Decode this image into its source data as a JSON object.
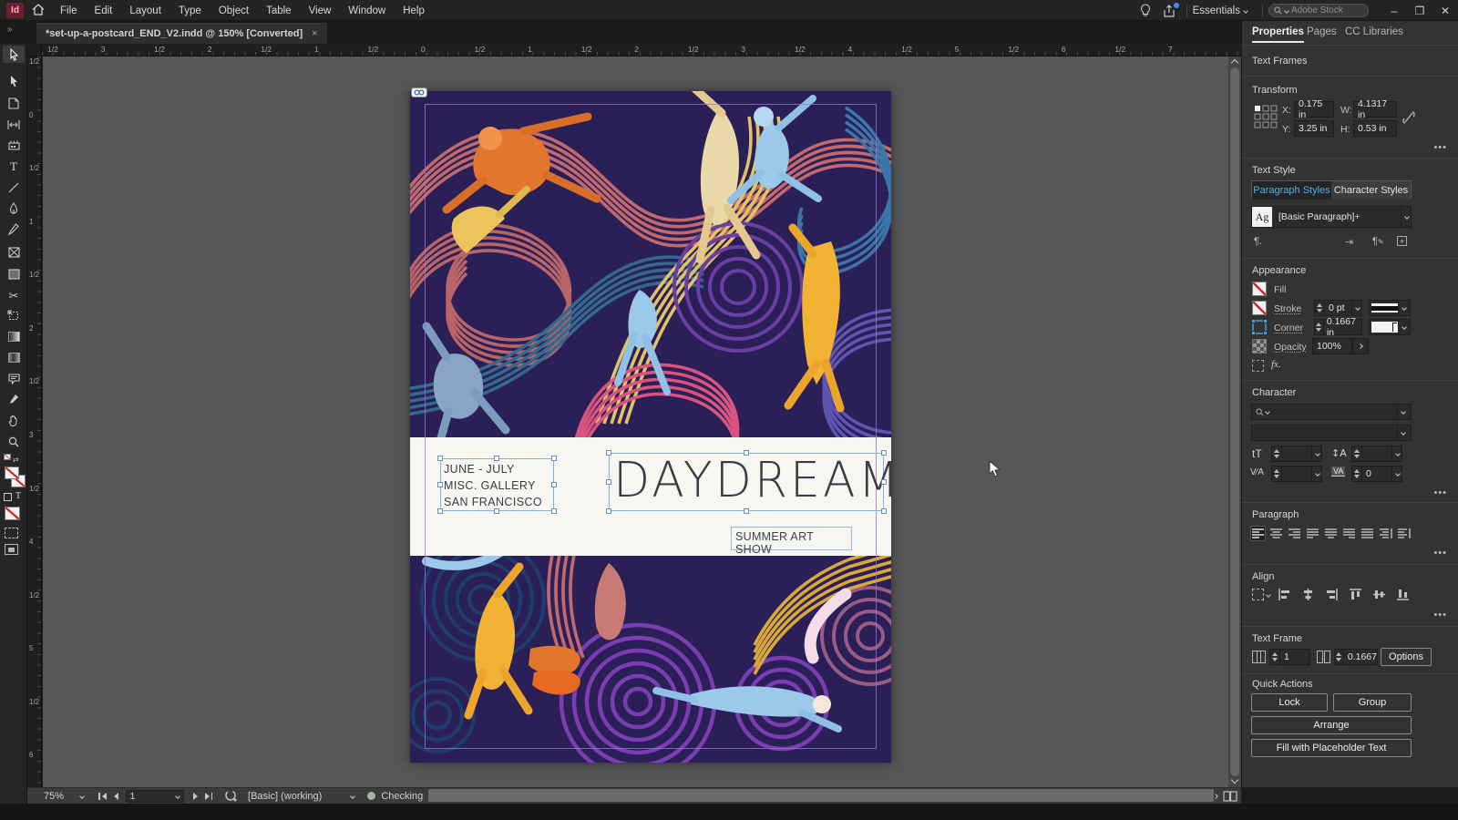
{
  "window": {
    "app_badge": "Id",
    "menu": [
      "File",
      "Edit",
      "Layout",
      "Type",
      "Object",
      "Table",
      "View",
      "Window",
      "Help"
    ],
    "workspace": "Essentials",
    "search_placeholder": "Adobe Stock",
    "min_label": "–",
    "restore_label": "❐",
    "close_label": "✕"
  },
  "icons": {
    "more": "•••",
    "expand": "»",
    "fx": "fx.",
    "pilcrow": "¶.",
    "pilcrow_edit": "¶",
    "plus_box": "+",
    "ag": "Ag",
    "size": "tT",
    "leading": "↕A",
    "kerning": "V⁄A",
    "tracking": "VA"
  },
  "tab": {
    "title": "*set-up-a-postcard_END_V2.indd @ 150% [Converted]",
    "close": "×"
  },
  "rulers": {
    "h": [
      "1/2",
      "3",
      "1/2",
      "2",
      "1/2",
      "1",
      "1/2",
      "0",
      "1/2",
      "1",
      "1/2",
      "2",
      "1/2",
      "3",
      "1/2",
      "4",
      "1/2",
      "5",
      "1/2",
      "6",
      "1/2",
      "7"
    ],
    "v": [
      "1/2",
      "0",
      "1/2",
      "1",
      "1/2",
      "2",
      "1/2",
      "3",
      "1/2",
      "4",
      "1/2",
      "5",
      "1/2",
      "6"
    ]
  },
  "postcard": {
    "dates": "JUNE - JULY\nMISC. GALLERY\nSAN FRANCISCO",
    "title": "DAYDREAM",
    "subtitle": "SUMMER ART SHOW",
    "palette": {
      "background": "#2a2057",
      "salmon": "#c2696e",
      "blue": "#33688f",
      "purple": "#7a3db2",
      "magenta": "#d8547e",
      "yellow": "#ecc45c",
      "orange": "#e2762d",
      "cream": "#ead9a8",
      "light_blue": "#9cc8ea",
      "steel": "#88a6c4",
      "navy_swirl": "#1e3c6e",
      "mauve": "#9a5a86",
      "band": "#f8f6f1"
    },
    "guide_color": "#9276cd",
    "selection_color": "#7db3de"
  },
  "panel": {
    "tabs": [
      "Properties",
      "Pages",
      "CC Libraries"
    ],
    "active_tab": "Properties",
    "context_label": "Text Frames",
    "transform": {
      "label": "Transform",
      "x_label": "X:",
      "x": "0.175 in",
      "y_label": "Y:",
      "y": "3.25 in",
      "w_label": "W:",
      "w": "4.1317 in",
      "h_label": "H:",
      "h": "0.53 in"
    },
    "text_style": {
      "label": "Text Style",
      "tab_paragraph": "Paragraph Styles",
      "tab_character": "Character Styles",
      "style_badge": "Ag",
      "style_name": "[Basic Paragraph]+"
    },
    "appearance": {
      "label": "Appearance",
      "fill": "Fill",
      "stroke": "Stroke",
      "stroke_value": "0 pt",
      "corner": "Corner",
      "corner_value": "0.1667 in",
      "opacity": "Opacity",
      "opacity_value": "100%"
    },
    "character": {
      "label": "Character",
      "tracking_value": "0"
    },
    "paragraph": {
      "label": "Paragraph"
    },
    "align": {
      "label": "Align"
    },
    "text_frame": {
      "label": "Text Frame",
      "columns": "1",
      "gutter": "0.1667",
      "options": "Options"
    },
    "quick_actions": {
      "label": "Quick Actions",
      "buttons": [
        "Lock",
        "Group",
        "Arrange",
        "Fill with Placeholder Text"
      ]
    }
  },
  "statusbar": {
    "zoom": "75%",
    "page": "1",
    "preset": "[Basic] (working)",
    "preflight": "Checking"
  }
}
